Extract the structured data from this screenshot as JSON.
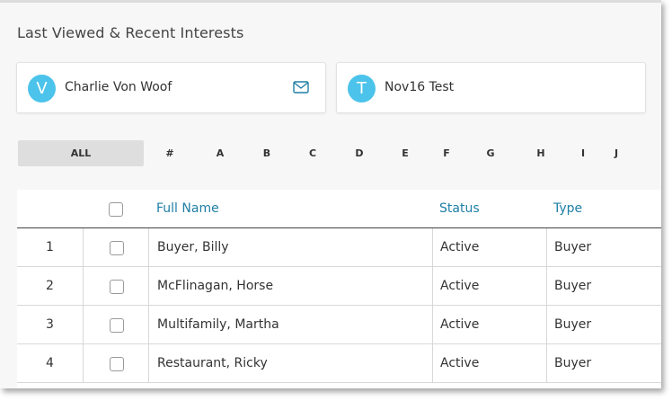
{
  "section": {
    "title": "Last Viewed & Recent Interests"
  },
  "recent": [
    {
      "initial": "V",
      "name": "Charlie Von Woof",
      "icon": "mail-icon",
      "accent": "#4cc3ea"
    },
    {
      "initial": "T",
      "name": "Nov16 Test",
      "accent": "#4cc3ea"
    }
  ],
  "alphabet": {
    "all_label": "ALL",
    "letters": [
      "#",
      "A",
      "B",
      "C",
      "D",
      "E",
      "F",
      "G",
      "H",
      "I",
      "J"
    ]
  },
  "table": {
    "headers": {
      "name": "Full Name",
      "status": "Status",
      "type": "Type"
    },
    "rows": [
      {
        "num": "1",
        "name": "Buyer, Billy",
        "status": "Active",
        "type": "Buyer"
      },
      {
        "num": "2",
        "name": "McFlinagan, Horse",
        "status": "Active",
        "type": "Buyer"
      },
      {
        "num": "3",
        "name": "Multifamily, Martha",
        "status": "Active",
        "type": "Buyer"
      },
      {
        "num": "4",
        "name": "Restaurant, Ricky",
        "status": "Active",
        "type": "Buyer"
      }
    ]
  },
  "colors": {
    "header_link": "#1f7fa6",
    "avatar": "#4cc3ea",
    "all_bg": "#dedede"
  }
}
